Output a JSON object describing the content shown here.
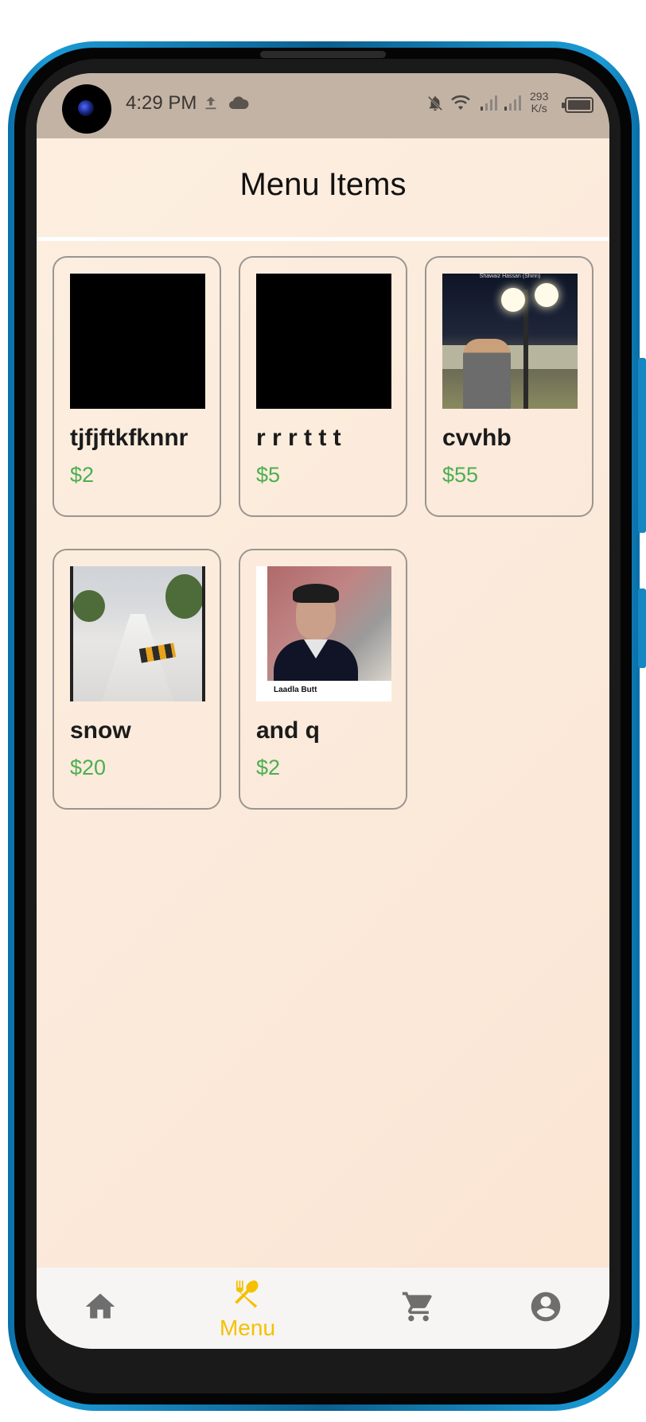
{
  "status_bar": {
    "time": "4:29 PM",
    "net_speed_value": "293",
    "net_speed_unit": "K/s"
  },
  "header": {
    "title": "Menu Items"
  },
  "menu_items": [
    {
      "name": "tjfjftkfknnr",
      "price": "$2",
      "image": "blank"
    },
    {
      "name": "r r r t t t",
      "price": "$5",
      "image": "blank"
    },
    {
      "name": "cvvhb",
      "price": "$55",
      "image": "night-portrait",
      "image_caption": "Shawaiz Hassan (Shirin)"
    },
    {
      "name": "snow",
      "price": "$20",
      "image": "snowy-road"
    },
    {
      "name": "and q",
      "price": "$2",
      "image": "boy-portrait",
      "image_caption": "Laadla Butt"
    }
  ],
  "bottom_nav": {
    "items": [
      {
        "id": "home",
        "icon": "home-icon",
        "active": false
      },
      {
        "id": "menu",
        "icon": "fork-spoon-icon",
        "label": "Menu",
        "active": true
      },
      {
        "id": "cart",
        "icon": "cart-icon",
        "active": false
      },
      {
        "id": "profile",
        "icon": "account-icon",
        "active": false
      }
    ],
    "active_color": "#f5c000",
    "inactive_color": "#6e6e6e"
  },
  "colors": {
    "price": "#4caf50",
    "status_bar": "#c3b3a5",
    "background": "#fdefe0"
  }
}
